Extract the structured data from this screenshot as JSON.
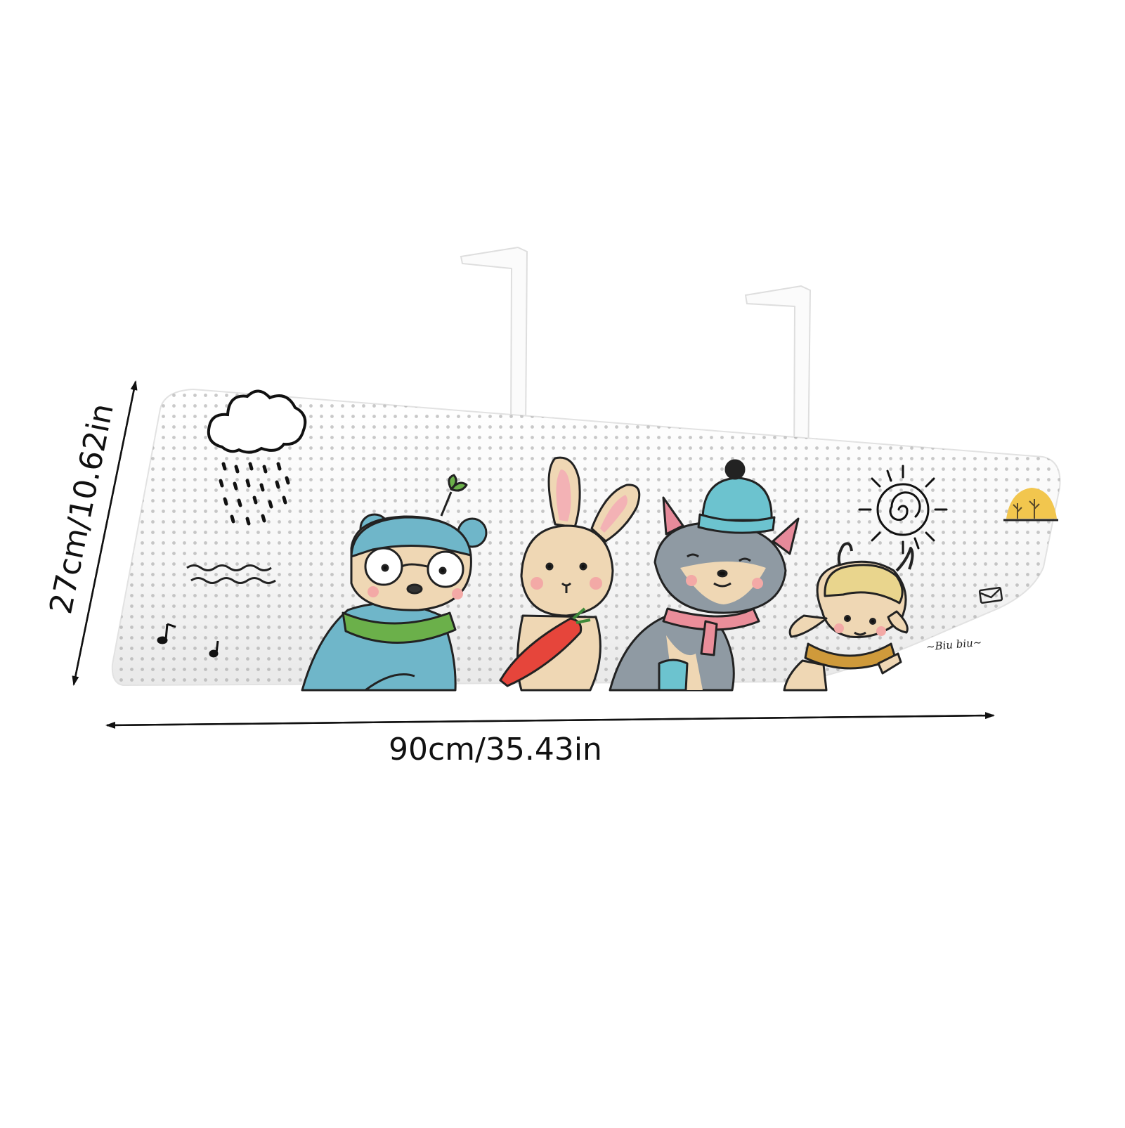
{
  "product": {
    "description": "Cartoon-printed perforated air conditioner wind deflector with two hanging brackets",
    "characters": [
      "bear",
      "rabbit",
      "fox",
      "sheep"
    ],
    "decor_icons": [
      "cloud-rain-icon",
      "waves-icon",
      "music-note-icon",
      "sun-icon",
      "tree-icon",
      "envelope-icon"
    ],
    "signature_text": "~Biu biu~"
  },
  "dimensions": {
    "width_label": "90cm/35.43in",
    "height_label": "27cm/10.62in"
  },
  "colors": {
    "background": "#ffffff",
    "panel": "#f6f6f6",
    "bear_blue": "#6fb6c9",
    "scarf_green": "#6bb04a",
    "rabbit_tan": "#efd7b4",
    "carrot_red": "#e6453b",
    "fox_grey": "#8f9aa3",
    "hat_teal": "#6cc3cf",
    "fox_scarf_pink": "#ea8e9a",
    "sheep_yellow": "#e9d58d",
    "sheep_scarf": "#cf9a3b",
    "sun_hill": "#f2c64e",
    "arrow_black": "#111111"
  }
}
